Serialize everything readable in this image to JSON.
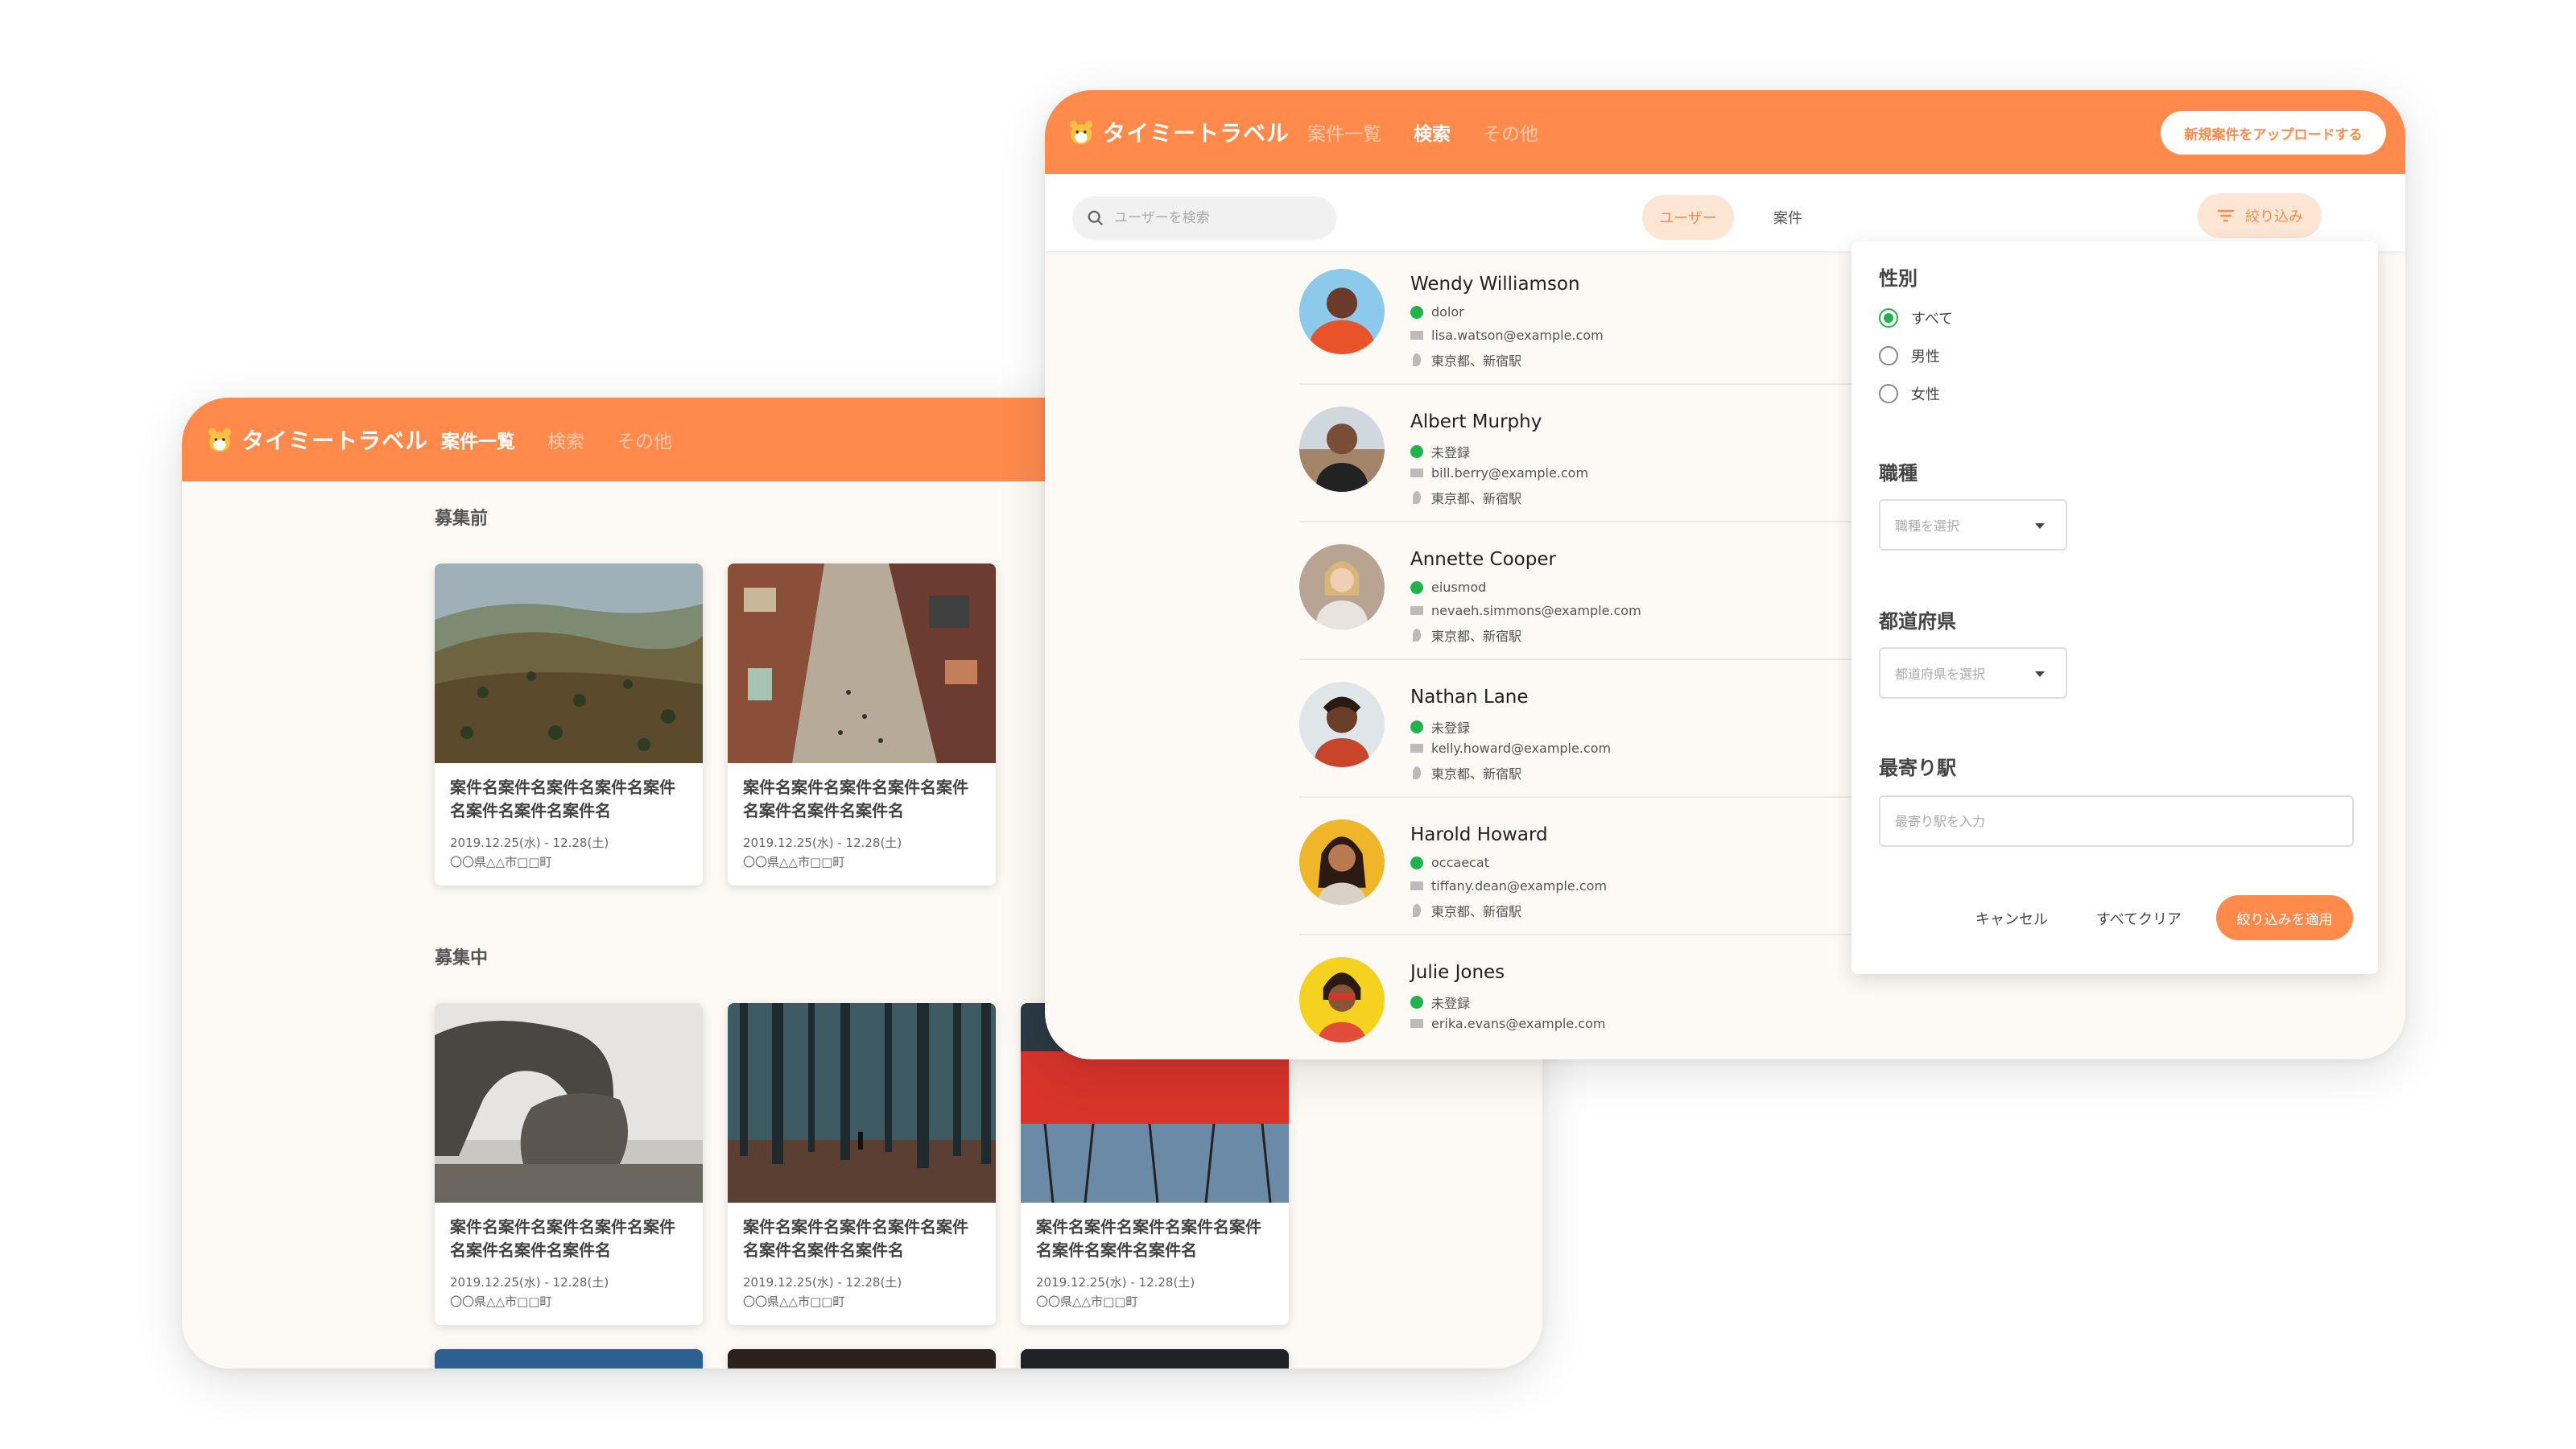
{
  "app": {
    "brand": "タイミートラベル",
    "brand_color": "#ff8a4c",
    "logo_icon": "hamster-icon"
  },
  "back_window": {
    "nav": [
      "案件一覧",
      "検索",
      "その他"
    ],
    "active_nav": "案件一覧",
    "sections": [
      {
        "title": "募集前",
        "cards": [
          {
            "title": "案件名案件名案件名案件名案件名案件名案件名案件名",
            "date": "2019.12.25(水) - 12.28(土)",
            "place": "〇〇県△△市□□町",
            "image": "hillside-photo"
          },
          {
            "title": "案件名案件名案件名案件名案件名案件名案件名案件名",
            "date": "2019.12.25(水) - 12.28(土)",
            "place": "〇〇県△△市□□町",
            "image": "town-street-photo"
          }
        ]
      },
      {
        "title": "募集中",
        "cards": [
          {
            "title": "案件名案件名案件名案件名案件名案件名案件名案件名",
            "date": "2019.12.25(水) - 12.28(土)",
            "place": "〇〇県△△市□□町",
            "image": "sea-rock-photo"
          },
          {
            "title": "案件名案件名案件名案件名案件名案件名案件名案件名",
            "date": "2019.12.25(水) - 12.28(土)",
            "place": "〇〇県△△市□□町",
            "image": "forest-photo"
          },
          {
            "title": "案件名案件名案件名案件名案件名案件名案件名案件名",
            "date": "2019.12.25(水) - 12.28(土)",
            "place": "〇〇県△△市□□町",
            "image": "red-grass-photo"
          }
        ]
      }
    ]
  },
  "front_window": {
    "nav": [
      "案件一覧",
      "検索",
      "その他"
    ],
    "active_nav": "検索",
    "upload_button": "新規案件をアップロードする",
    "search": {
      "placeholder": "ユーザーを検索",
      "value": ""
    },
    "tabs": [
      "ユーザー",
      "案件"
    ],
    "active_tab": "ユーザー",
    "filter_button": "絞り込み",
    "users": [
      {
        "name": "Wendy Williamson",
        "status": "dolor",
        "email": "lisa.watson@example.com",
        "location": "東京都、新宿駅"
      },
      {
        "name": "Albert Murphy",
        "status": "未登録",
        "email": "bill.berry@example.com",
        "location": "東京都、新宿駅"
      },
      {
        "name": "Annette Cooper",
        "status": "eiusmod",
        "email": "nevaeh.simmons@example.com",
        "location": "東京都、新宿駅"
      },
      {
        "name": "Nathan Lane",
        "status": "未登録",
        "email": "kelly.howard@example.com",
        "location": "東京都、新宿駅"
      },
      {
        "name": "Harold Howard",
        "status": "occaecat",
        "email": "tiffany.dean@example.com",
        "location": "東京都、新宿駅"
      },
      {
        "name": "Julie Jones",
        "status": "未登録",
        "email": "erika.evans@example.com",
        "location": ""
      }
    ],
    "filter_panel": {
      "gender_label": "性別",
      "gender_options": [
        "すべて",
        "男性",
        "女性"
      ],
      "gender_selected": "すべて",
      "job_label": "職種",
      "job_placeholder": "職種を選択",
      "pref_label": "都道府県",
      "pref_placeholder": "都道府県を選択",
      "station_label": "最寄り駅",
      "station_placeholder": "最寄り駅を入力",
      "cancel": "キャンセル",
      "clear": "すべてクリア",
      "apply": "絞り込みを適用"
    }
  }
}
